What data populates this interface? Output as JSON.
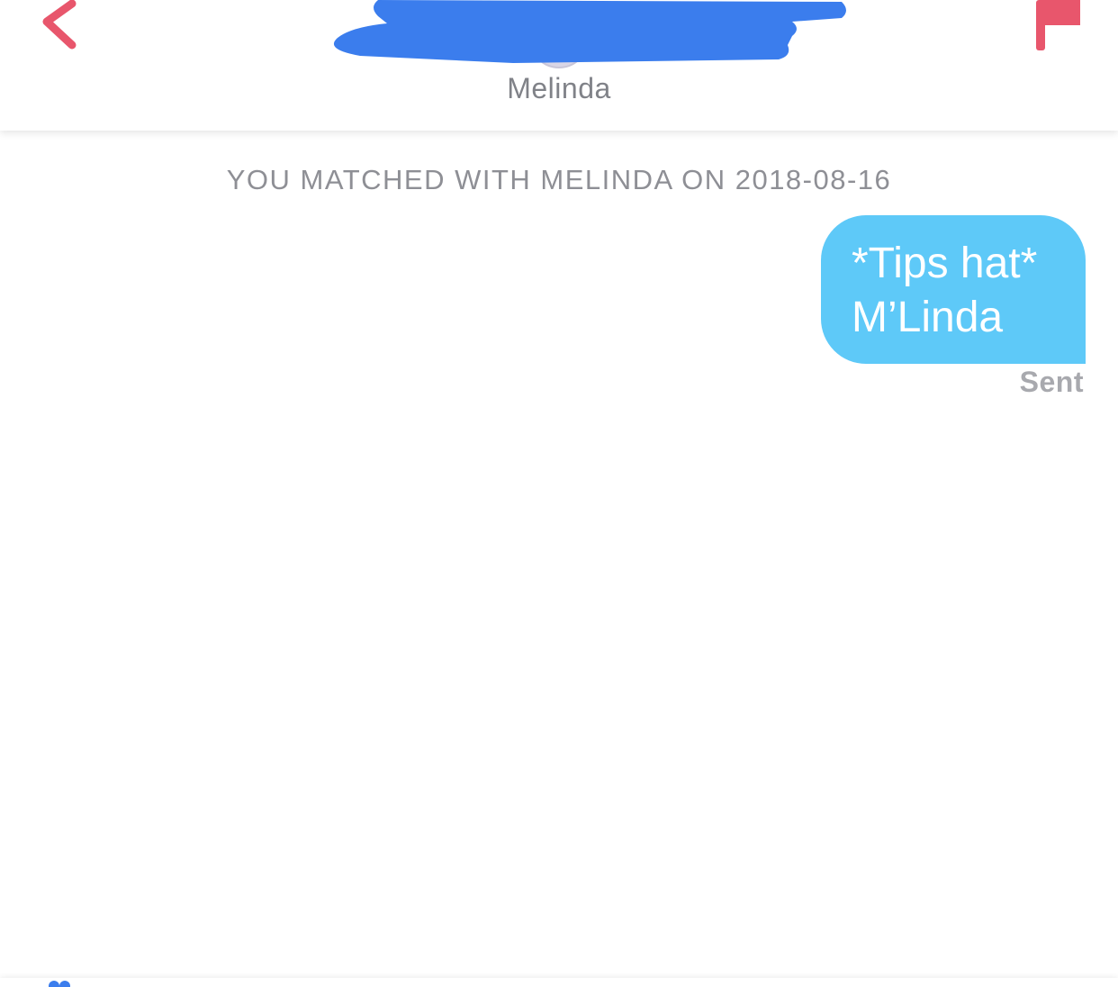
{
  "header": {
    "match_name": "Melinda"
  },
  "conversation": {
    "match_notice": "YOU MATCHED WITH MELINDA ON 2018-08-16",
    "messages": [
      {
        "direction": "outgoing",
        "lines": [
          "*Tips hat*",
          "M’Linda"
        ],
        "status": "Sent"
      }
    ]
  },
  "colors": {
    "accent": "#e8566c",
    "bubble": "#5ec9f8",
    "redaction": "#3b7ded",
    "muted_text": "#8e8f95"
  },
  "icons": {
    "back": "chevron-left-icon",
    "report": "flag-icon",
    "bottom": "heart-icon"
  }
}
